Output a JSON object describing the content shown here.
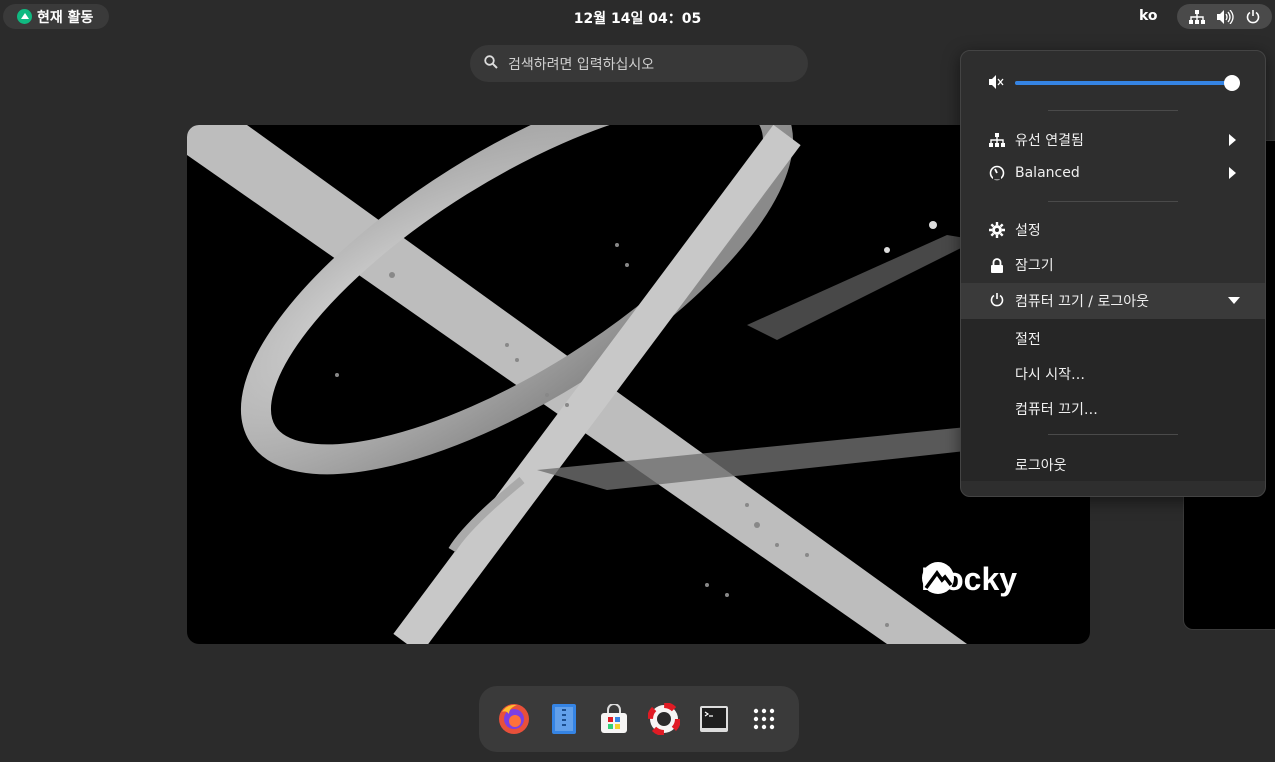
{
  "topbar": {
    "activities_label": "현재 활동",
    "clock": "12월 14일  04：05",
    "language": "ko",
    "tray_icons": [
      "network-icon",
      "volume-icon",
      "power-icon"
    ]
  },
  "search": {
    "placeholder": "검색하려면 입력하십시오"
  },
  "wallpaper": {
    "brand_text": "Rocky"
  },
  "dock": {
    "apps": [
      "firefox-icon",
      "text-editor-icon",
      "software-icon",
      "help-icon",
      "terminal-icon",
      "show-apps-icon"
    ]
  },
  "quick_menu": {
    "volume_level": 1.0,
    "volume_color": "#3584e4",
    "items": {
      "wired": "유선 연결됨",
      "power_mode": "Balanced",
      "settings": "설정",
      "lock": "잠그기",
      "power_off_logout": "컴퓨터 끄기 / 로그아웃"
    },
    "submenu": {
      "suspend": "절전",
      "restart": "다시 시작…",
      "power_off": "컴퓨터 끄기…",
      "logout": "로그아웃"
    }
  }
}
